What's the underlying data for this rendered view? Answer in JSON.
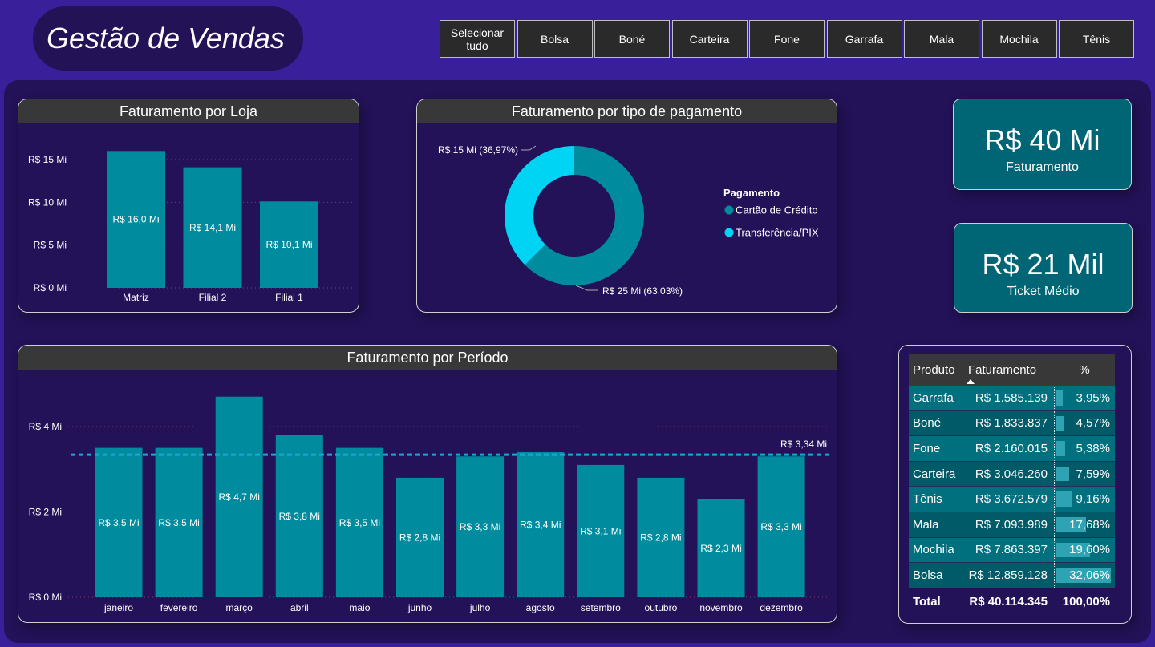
{
  "header": {
    "title": "Gestão de Vendas"
  },
  "slicer": {
    "buttons": [
      "Selecionar tudo",
      "Bolsa",
      "Boné",
      "Carteira",
      "Fone",
      "Garrafa",
      "Mala",
      "Mochila",
      "Tênis"
    ]
  },
  "kpis": {
    "faturamento": {
      "value": "R$ 40 Mi",
      "label": "Faturamento"
    },
    "ticket": {
      "value": "R$ 21 Mil",
      "label": "Ticket Médio"
    }
  },
  "colors": {
    "bar": "#008c9e",
    "donut_primary": "#008c9e",
    "donut_secondary": "#00d4f5",
    "avg_line": "#1aa7d6"
  },
  "chart_data": [
    {
      "id": "loja",
      "type": "bar",
      "title": "Faturamento por Loja",
      "categories": [
        "Matriz",
        "Filial 2",
        "Filial 1"
      ],
      "values": [
        16.0,
        14.1,
        10.1
      ],
      "data_labels": [
        "R$ 16,0 Mi",
        "R$ 14,1 Mi",
        "R$ 10,1 Mi"
      ],
      "yticks": [
        0,
        5,
        10,
        15
      ],
      "ytick_labels": [
        "R$ 0 Mi",
        "R$ 5 Mi",
        "R$ 10 Mi",
        "R$ 15 Mi"
      ],
      "ylim": [
        0,
        17
      ],
      "grid": true
    },
    {
      "id": "pagamento",
      "type": "pie",
      "title": "Faturamento por tipo de pagamento",
      "legend_title": "Pagamento",
      "labels": [
        "Cartão de Crédito",
        "Transferência/PIX"
      ],
      "values": [
        25,
        15
      ],
      "percents": [
        63.03,
        36.97
      ],
      "data_labels": [
        "R$ 25 Mi (63,03%)",
        "R$ 15 Mi (36,97%)"
      ],
      "legend_position": "right"
    },
    {
      "id": "periodo",
      "type": "bar",
      "title": "Faturamento por Período",
      "categories": [
        "janeiro",
        "fevereiro",
        "março",
        "abril",
        "maio",
        "junho",
        "julho",
        "agosto",
        "setembro",
        "outubro",
        "novembro",
        "dezembro"
      ],
      "values": [
        3.5,
        3.5,
        4.7,
        3.8,
        3.5,
        2.8,
        3.3,
        3.4,
        3.1,
        2.8,
        2.3,
        3.3
      ],
      "data_labels": [
        "R$ 3,5 Mi",
        "R$ 3,5 Mi",
        "R$ 4,7 Mi",
        "R$ 3,8 Mi",
        "R$ 3,5 Mi",
        "R$ 2,8 Mi",
        "R$ 3,3 Mi",
        "R$ 3,4 Mi",
        "R$ 3,1 Mi",
        "R$ 2,8 Mi",
        "R$ 2,3 Mi",
        "R$ 3,3 Mi"
      ],
      "average": 3.34,
      "average_label": "R$ 3,34 Mi",
      "yticks": [
        0,
        2,
        4
      ],
      "ytick_labels": [
        "R$ 0 Mi",
        "R$ 2 Mi",
        "R$ 4 Mi"
      ],
      "ylim": [
        0,
        4.8
      ],
      "grid": true
    }
  ],
  "table": {
    "headers": [
      "Produto",
      "Faturamento",
      "%"
    ],
    "rows": [
      {
        "produto": "Garrafa",
        "faturamento": "R$ 1.585.139",
        "pct_label": "3,95%",
        "pct": 3.95
      },
      {
        "produto": "Boné",
        "faturamento": "R$ 1.833.837",
        "pct_label": "4,57%",
        "pct": 4.57
      },
      {
        "produto": "Fone",
        "faturamento": "R$ 2.160.015",
        "pct_label": "5,38%",
        "pct": 5.38
      },
      {
        "produto": "Carteira",
        "faturamento": "R$ 3.046.260",
        "pct_label": "7,59%",
        "pct": 7.59
      },
      {
        "produto": "Tênis",
        "faturamento": "R$ 3.672.579",
        "pct_label": "9,16%",
        "pct": 9.16
      },
      {
        "produto": "Mala",
        "faturamento": "R$ 7.093.989",
        "pct_label": "17,68%",
        "pct": 17.68
      },
      {
        "produto": "Mochila",
        "faturamento": "R$ 7.863.397",
        "pct_label": "19,60%",
        "pct": 19.6
      },
      {
        "produto": "Bolsa",
        "faturamento": "R$ 12.859.128",
        "pct_label": "32,06%",
        "pct": 32.06
      }
    ],
    "total": {
      "label": "Total",
      "faturamento": "R$ 40.114.345",
      "pct_label": "100,00%"
    }
  }
}
